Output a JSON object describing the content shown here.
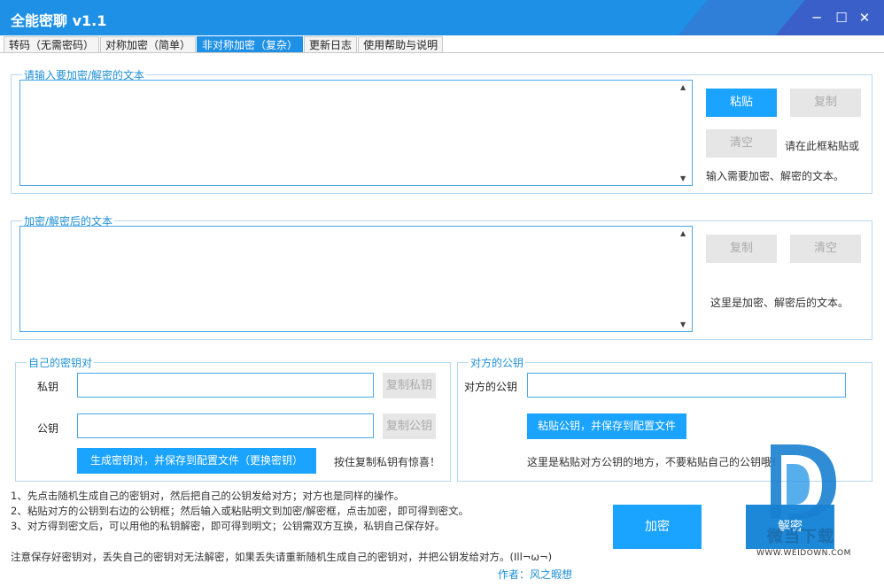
{
  "window": {
    "title": "全能密聊 v1.1"
  },
  "tabs": [
    "转码（无需密码）",
    "对称加密（简单）",
    "非对称加密（复杂）",
    "更新日志",
    "使用帮助与说明"
  ],
  "input_group": {
    "legend": "请输入要加密/解密的文本",
    "paste": "粘贴",
    "copy": "复制",
    "clear": "清空",
    "hint1": "请在此框粘贴或",
    "hint2": "输入需要加密、解密的文本。"
  },
  "output_group": {
    "legend": "加密/解密后的文本",
    "copy": "复制",
    "clear": "清空",
    "hint": "这里是加密、解密后的文本。"
  },
  "own_keys": {
    "legend": "自己的密钥对",
    "private_label": "私钥",
    "public_label": "公钥",
    "copy_private": "复制私钥",
    "copy_public": "复制公钥",
    "generate": "生成密钥对，并保存到配置文件（更换密钥）",
    "hint": "按住复制私钥有惊喜！"
  },
  "peer_key": {
    "legend": "对方的公钥",
    "label": "对方的公钥",
    "paste": "粘贴公钥，并保存到配置文件",
    "hint": "这里是粘贴对方公钥的地方，不要粘贴自己的公钥哦！"
  },
  "notes": [
    "1、先点击随机生成自己的密钥对，然后把自己的公钥发给对方；对方也是同样的操作。",
    "2、粘贴对方的公钥到右边的公钥框；然后输入或粘贴明文到加密/解密框，点击加密，即可得到密文。",
    "3、对方得到密文后，可以用他的私钥解密，即可得到明文；公钥需双方互换，私钥自己保存好。"
  ],
  "warning": "注意保存好密钥对，丢失自己的密钥对无法解密，如果丢失请重新随机生成自己的密钥对，并把公钥发给对方。(Ill¬ω¬)",
  "author": "作者：风之暇想",
  "encrypt": "加密",
  "decrypt": "解密",
  "watermark": {
    "text": "微当下载",
    "url": "WWW.WEIDOWN.COM"
  },
  "colors": {
    "titlebar": "#1e90e6",
    "button": "#1aa3ff",
    "encrypt_bg": "#1aa3ff",
    "decrypt_bg": "#1e88d8"
  }
}
